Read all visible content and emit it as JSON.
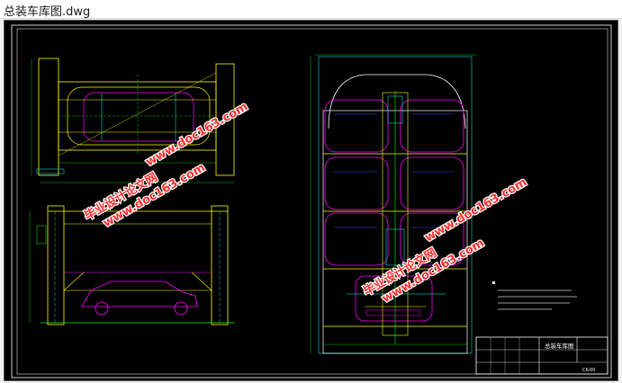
{
  "window": {
    "title": "总装车库图.dwg"
  },
  "watermarks": [
    {
      "line1": "毕业设计论文网",
      "line2": "www.doc163.com"
    },
    {
      "line1": "www.doc163.com"
    },
    {
      "line1": "毕业设计论文网",
      "line2": "www.doc163.com"
    },
    {
      "line1": "www.doc163.com"
    }
  ],
  "title_block": {
    "drawing_name": "总装车库图",
    "code": "CK-00"
  },
  "colors": {
    "background": "#000000",
    "frame": "#ffffff",
    "lines_yellow": "#ffff00",
    "lines_magenta": "#ff00ff",
    "lines_cyan": "#00ffff",
    "lines_green": "#00ff00",
    "lines_blue": "#4040ff",
    "watermark": "#ff3030"
  }
}
